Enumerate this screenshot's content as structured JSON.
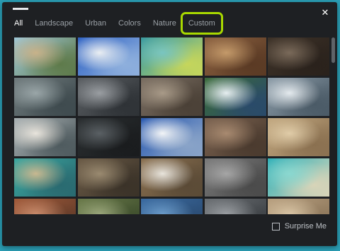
{
  "tabs": [
    {
      "label": "All",
      "active": true,
      "highlighted": false
    },
    {
      "label": "Landscape",
      "active": false,
      "highlighted": false
    },
    {
      "label": "Urban",
      "active": false,
      "highlighted": false
    },
    {
      "label": "Colors",
      "active": false,
      "highlighted": false
    },
    {
      "label": "Nature",
      "active": false,
      "highlighted": false
    },
    {
      "label": "Custom",
      "active": false,
      "highlighted": true
    }
  ],
  "close_icon": "close-icon",
  "highlight_color": "#a8d800",
  "surprise": {
    "label": "Surprise Me",
    "checked": false
  },
  "wallpapers": [
    {
      "name": "beach",
      "colors": [
        "#9fc7d6",
        "#c8b28a",
        "#5e7a4a"
      ]
    },
    {
      "name": "white-building",
      "colors": [
        "#2f63c4",
        "#eaeef2",
        "#8fb0dd"
      ]
    },
    {
      "name": "teal-geometric",
      "colors": [
        "#3a9aa0",
        "#79c5c0",
        "#c6d65b"
      ]
    },
    {
      "name": "desert-crater",
      "colors": [
        "#8a6040",
        "#c49a6a",
        "#5a3a24"
      ]
    },
    {
      "name": "dark-volcano",
      "colors": [
        "#3d3228",
        "#7a6a5a",
        "#2a221c"
      ]
    },
    {
      "name": "aerial-stadium",
      "colors": [
        "#6f7a7c",
        "#9aa6a8",
        "#3e4a4e"
      ]
    },
    {
      "name": "rock-ridges",
      "colors": [
        "#5a5e62",
        "#9a9ea2",
        "#2e3236"
      ]
    },
    {
      "name": "mountain-folds",
      "colors": [
        "#7a6e62",
        "#a89a88",
        "#4a4036"
      ]
    },
    {
      "name": "green-coast",
      "colors": [
        "#3a6a3a",
        "#e6eef0",
        "#2a4a6a"
      ]
    },
    {
      "name": "snow-ridges",
      "colors": [
        "#8a9aa6",
        "#e4eaee",
        "#4a5a66"
      ]
    },
    {
      "name": "coastal-dunes",
      "colors": [
        "#a8b0b2",
        "#e8e4dc",
        "#4e5a5e"
      ]
    },
    {
      "name": "dark-terrain",
      "colors": [
        "#2a2e30",
        "#5a6064",
        "#1a1c1e"
      ]
    },
    {
      "name": "snowy-peak",
      "colors": [
        "#2a5ab0",
        "#f2f4f6",
        "#8aa4c8"
      ]
    },
    {
      "name": "brown-plateau",
      "colors": [
        "#7a6250",
        "#a88a70",
        "#4a3a2e"
      ]
    },
    {
      "name": "sand-hills",
      "colors": [
        "#c2a880",
        "#e0cca8",
        "#8a7050"
      ]
    },
    {
      "name": "lagoon-city",
      "colors": [
        "#3aa6a0",
        "#c8b890",
        "#2a6a70"
      ]
    },
    {
      "name": "ancient-city",
      "colors": [
        "#6a5a46",
        "#9a8a70",
        "#3a3228"
      ]
    },
    {
      "name": "river-delta",
      "colors": [
        "#8a7050",
        "#e8e4dc",
        "#5a4a36"
      ]
    },
    {
      "name": "city-grid",
      "colors": [
        "#7a7a7a",
        "#a6a6a6",
        "#4a4a4a"
      ]
    },
    {
      "name": "turquoise-water",
      "colors": [
        "#30b0b8",
        "#8ad8d0",
        "#d8d4b8"
      ]
    },
    {
      "name": "red-canyon",
      "colors": [
        "#a05a3a",
        "#c88a6a",
        "#603a28"
      ]
    },
    {
      "name": "green-fields",
      "colors": [
        "#6a7a4a",
        "#9aa67a",
        "#3a4a2a"
      ]
    },
    {
      "name": "blue-sea",
      "colors": [
        "#3a6aa0",
        "#6a9ac8",
        "#2a4a70"
      ]
    },
    {
      "name": "gray-city",
      "colors": [
        "#6a6e72",
        "#9a9ea2",
        "#3a3e42"
      ]
    },
    {
      "name": "tan-desert",
      "colors": [
        "#b8a080",
        "#d8c4a4",
        "#8a7458"
      ]
    }
  ]
}
